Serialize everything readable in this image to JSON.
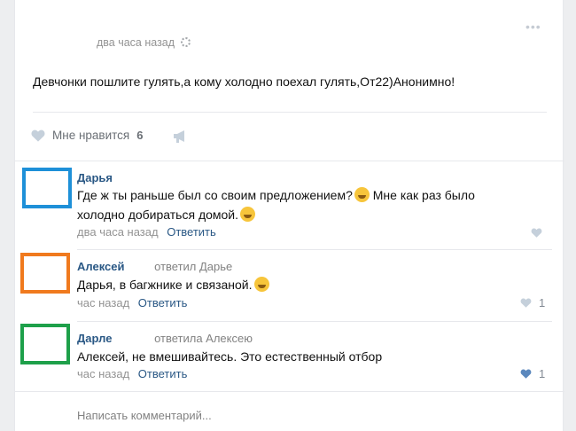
{
  "post": {
    "time": "два часа назад",
    "text": "Девчонки пошлите гулять,а кому холодно поехал гулять,От22)Анонимно!",
    "like_label": "Мне нравится",
    "like_count": "6",
    "more_glyph": "•••"
  },
  "comments": [
    {
      "author": "Дарья",
      "reply_to": "",
      "text_line1": "Где ж ты раньше был со своим предложением?",
      "text_line1_after_emoji": " Мне как раз было",
      "text_line2": "холодно добираться домой.",
      "time": "два часа назад",
      "reply_label": "Ответить",
      "likes": "",
      "avatar_color": "#1e90d8"
    },
    {
      "author": "Алексей",
      "reply_to": "ответил Дарье",
      "text_line1": "Дарья, в багжнике и связаной.",
      "time": "час назад",
      "reply_label": "Ответить",
      "likes": "1",
      "avatar_color": "#f07a1e"
    },
    {
      "author": "Дарле",
      "reply_to": "ответила Алексею",
      "text_line1": "Алексей, не вмешивайтесь. Это естественный отбор",
      "time": "час назад",
      "reply_label": "Ответить",
      "likes": "1",
      "avatar_color": "#1ea04a"
    }
  ],
  "comment_input": {
    "placeholder": "Написать комментарий..."
  },
  "icons": {
    "like": "heart-icon",
    "share": "megaphone-icon",
    "settings": "gear-icon",
    "emoji": "emoji-icon"
  },
  "colors": {
    "link": "#2a5885",
    "muted": "#939393",
    "divider": "#e7e8ec"
  }
}
